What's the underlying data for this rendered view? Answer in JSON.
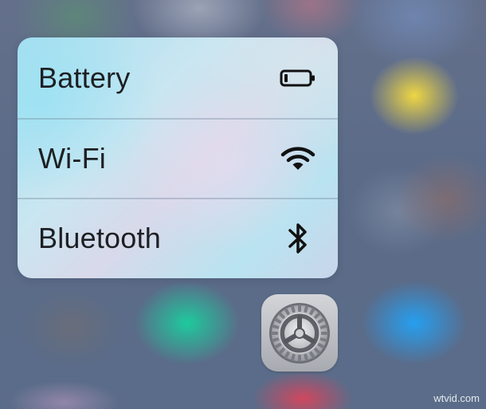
{
  "quick_actions": {
    "items": [
      {
        "label": "Battery",
        "icon": "battery-icon"
      },
      {
        "label": "Wi-Fi",
        "icon": "wifi-icon"
      },
      {
        "label": "Bluetooth",
        "icon": "bluetooth-icon"
      }
    ]
  },
  "app": {
    "icon": "settings-gear-icon"
  },
  "watermark": "wtvid.com",
  "colors": {
    "text": "#1d1f22",
    "icon": "#111111",
    "menu_background": "#c9e6f1",
    "app_icon_background": "#b8bbc0"
  }
}
